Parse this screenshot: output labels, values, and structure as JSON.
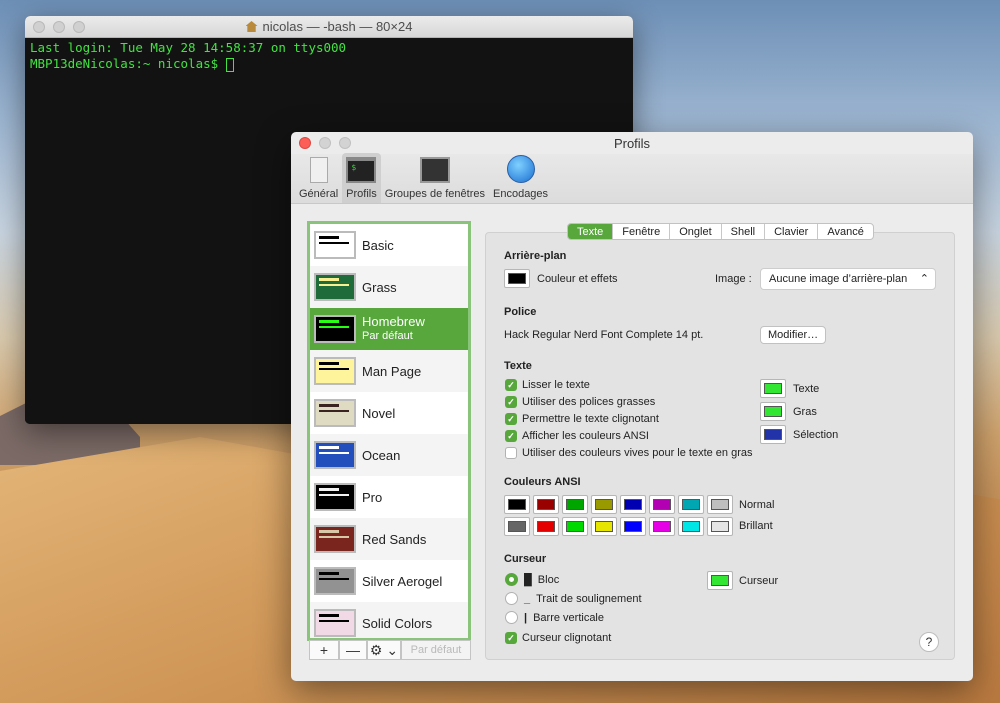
{
  "terminal": {
    "title": "nicolas — -bash — 80×24",
    "lines": [
      "Last login: Tue May 28 14:58:37 on ttys000",
      "MBP13deNicolas:~ nicolas$ "
    ]
  },
  "prefs": {
    "title": "Profils",
    "toolbar": [
      {
        "label": "Général",
        "icon": "general-icon"
      },
      {
        "label": "Profils",
        "icon": "profiles-icon"
      },
      {
        "label": "Groupes de fenêtres",
        "icon": "window-groups-icon"
      },
      {
        "label": "Encodages",
        "icon": "globe-icon"
      }
    ],
    "profiles": [
      {
        "name": "Basic",
        "colors": [
          "#ffffff",
          "#000000"
        ]
      },
      {
        "name": "Grass",
        "colors": [
          "#1f6b3a",
          "#f7ef92"
        ]
      },
      {
        "name": "Homebrew",
        "sub": "Par défaut",
        "colors": [
          "#000000",
          "#28fe14"
        ]
      },
      {
        "name": "Man Page",
        "colors": [
          "#fef49c",
          "#000000"
        ]
      },
      {
        "name": "Novel",
        "colors": [
          "#dfdbc3",
          "#3b2322"
        ]
      },
      {
        "name": "Ocean",
        "colors": [
          "#224fbc",
          "#ffffff"
        ]
      },
      {
        "name": "Pro",
        "colors": [
          "#000000",
          "#f2f2f2"
        ]
      },
      {
        "name": "Red Sands",
        "colors": [
          "#7a251e",
          "#d7c9a7"
        ]
      },
      {
        "name": "Silver Aerogel",
        "colors": [
          "#929292",
          "#000000"
        ]
      },
      {
        "name": "Solid Colors",
        "colors": [
          "#f2d9e6",
          "#000000"
        ]
      }
    ],
    "list_buttons": {
      "add": "+",
      "remove": "—",
      "gear": "⚙ ⌄",
      "default": "Par défaut"
    },
    "tabs": [
      "Texte",
      "Fenêtre",
      "Onglet",
      "Shell",
      "Clavier",
      "Avancé"
    ],
    "background": {
      "header": "Arrière-plan",
      "color_label": "Couleur et effets",
      "image_label": "Image :",
      "image_value": "Aucune image d’arrière-plan"
    },
    "font": {
      "header": "Police",
      "value": "Hack Regular Nerd Font Complete 14 pt.",
      "modify": "Modifier…"
    },
    "text": {
      "header": "Texte",
      "options": [
        {
          "label": "Lisser le texte",
          "checked": true
        },
        {
          "label": "Utiliser des polices grasses",
          "checked": true
        },
        {
          "label": "Permettre le texte clignotant",
          "checked": true
        },
        {
          "label": "Afficher les couleurs ANSI",
          "checked": true
        },
        {
          "label": "Utiliser des couleurs vives pour le texte en gras",
          "checked": false
        }
      ],
      "colors": [
        {
          "label": "Texte",
          "color": "#33e633"
        },
        {
          "label": "Gras",
          "color": "#33e633"
        },
        {
          "label": "Sélection",
          "color": "#2233aa"
        }
      ]
    },
    "ansi": {
      "header": "Couleurs ANSI",
      "normal_label": "Normal",
      "bright_label": "Brillant",
      "normal": [
        "#000000",
        "#990000",
        "#00a600",
        "#999900",
        "#0000b2",
        "#b200b2",
        "#00a6b2",
        "#bfbfbf"
      ],
      "bright": [
        "#666666",
        "#e50000",
        "#00d900",
        "#e5e500",
        "#0000ff",
        "#e500e5",
        "#00e5e5",
        "#e5e5e5"
      ]
    },
    "cursor": {
      "header": "Curseur",
      "options": [
        {
          "label": "Bloc",
          "glyph": "█",
          "selected": true
        },
        {
          "label": "Trait de soulignement",
          "glyph": "_",
          "selected": false
        },
        {
          "label": "Barre verticale",
          "glyph": "|",
          "selected": false
        }
      ],
      "color_label": "Curseur",
      "color": "#33e633",
      "blink_label": "Curseur clignotant",
      "blink": true
    },
    "help": "?"
  }
}
